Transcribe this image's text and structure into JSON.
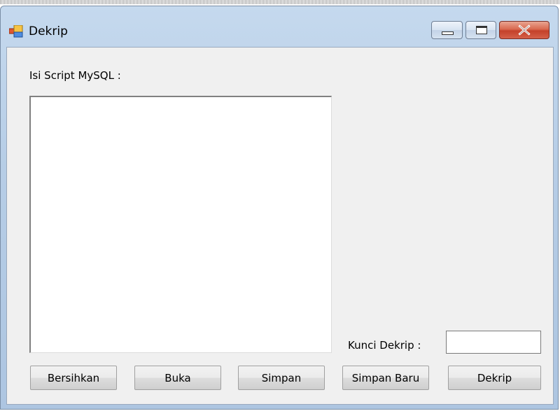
{
  "window": {
    "title": "Dekrip",
    "icon": "app-window-icon",
    "controls": [
      "minimize-icon",
      "maximize-icon",
      "close-icon"
    ]
  },
  "form": {
    "script_label": "Isi Script MySQL :",
    "script_value": "",
    "key_label": "Kunci Dekrip :",
    "key_value": ""
  },
  "buttons": {
    "clear": "Bersihkan",
    "open": "Buka",
    "save": "Simpan",
    "save_new": "Simpan Baru",
    "decrypt": "Dekrip"
  },
  "colors": {
    "client_background": "#f0f0f0",
    "title_bar": "#c5d9ee",
    "close_button": "#c4412a"
  }
}
